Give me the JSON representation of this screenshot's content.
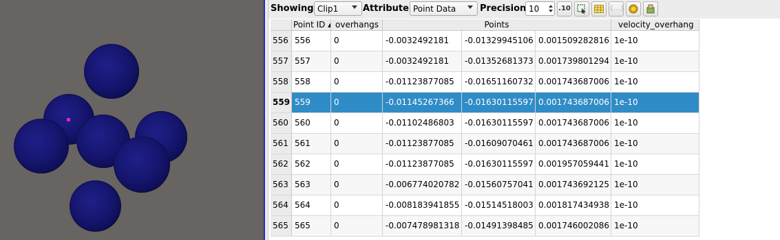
{
  "toolbar": {
    "showing_label": "Showing",
    "showing_value": "Clip1",
    "attribute_label": "Attribute:",
    "attribute_value": "Point Data",
    "precision_label": "Precision:",
    "precision_value": "10",
    "fixed_repr_glyph": ".10",
    "icons": [
      "fixed-representation-icon",
      "select-cells-icon",
      "toggle-columns-icon",
      "cell-connectivity-icon",
      "toggle-field-data-icon",
      "split-view-icon"
    ]
  },
  "table": {
    "columns": [
      "Point ID",
      "overhangs",
      "Points",
      "velocity_overhang"
    ],
    "rows": [
      {
        "index": "556",
        "cells": [
          "556",
          "0",
          "-0.0032492181",
          "-0.01329945106",
          "0.001509282816",
          "1e-10"
        ]
      },
      {
        "index": "557",
        "cells": [
          "557",
          "0",
          "-0.0032492181",
          "-0.01352681373",
          "0.001739801294",
          "1e-10"
        ]
      },
      {
        "index": "558",
        "cells": [
          "558",
          "0",
          "-0.01123877085",
          "-0.01651160732",
          "0.001743687006",
          "1e-10"
        ]
      },
      {
        "index": "559",
        "cells": [
          "559",
          "0",
          "-0.01145267366",
          "-0.01630115597",
          "0.001743687006",
          "1e-10"
        ],
        "selected": true
      },
      {
        "index": "560",
        "cells": [
          "560",
          "0",
          "-0.01102486803",
          "-0.01630115597",
          "0.001743687006",
          "1e-10"
        ]
      },
      {
        "index": "561",
        "cells": [
          "561",
          "0",
          "-0.01123877085",
          "-0.01609070461",
          "0.001743687006",
          "1e-10"
        ]
      },
      {
        "index": "562",
        "cells": [
          "562",
          "0",
          "-0.01123877085",
          "-0.01630115597",
          "0.001957059441",
          "1e-10"
        ]
      },
      {
        "index": "563",
        "cells": [
          "563",
          "0",
          "-0.006774020782",
          "-0.01560757041",
          "0.001743692125",
          "1e-10"
        ]
      },
      {
        "index": "564",
        "cells": [
          "564",
          "0",
          "-0.008183941855",
          "-0.01514518003",
          "0.001817434938",
          "1e-10"
        ]
      },
      {
        "index": "565",
        "cells": [
          "565",
          "0",
          "-0.007478981318",
          "-0.01491398485",
          "0.001746002086",
          "1e-10"
        ]
      }
    ]
  },
  "colors": {
    "viewport_bg": "#686461",
    "sphere": "#161670",
    "selection": "#308cc6",
    "marker": "#e020d0"
  }
}
